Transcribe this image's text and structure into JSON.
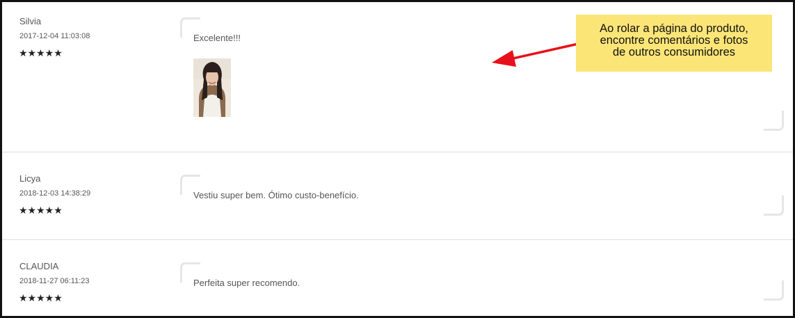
{
  "reviews": [
    {
      "author": "Silvia",
      "date": "2017-12-04 11:03:08",
      "stars": "★★★★★",
      "comment": "Excelente!!!",
      "rating": 5,
      "has_photo": true
    },
    {
      "author": "Licya",
      "date": "2018-12-03 14:38:29",
      "stars": "★★★★★",
      "comment": "Vestiu super bem. Ótimo custo-benefício.",
      "rating": 5,
      "has_photo": false
    },
    {
      "author": "CLAUDIA",
      "date": "2018-11-27 06:11:23",
      "stars": "★★★★★",
      "comment": "Perfeita super recomendo.",
      "rating": 5,
      "has_photo": false
    }
  ],
  "callout": {
    "lines": [
      "Ao rolar a página do produto,",
      "encontre comentários e fotos",
      "de outros consumidores"
    ],
    "background_color": "#fbe577",
    "arrow_color": "#e8101a"
  },
  "icons": {
    "star": "star-icon",
    "quote_open": "quote-open-icon",
    "quote_close": "quote-close-icon",
    "arrow": "arrow-icon"
  }
}
